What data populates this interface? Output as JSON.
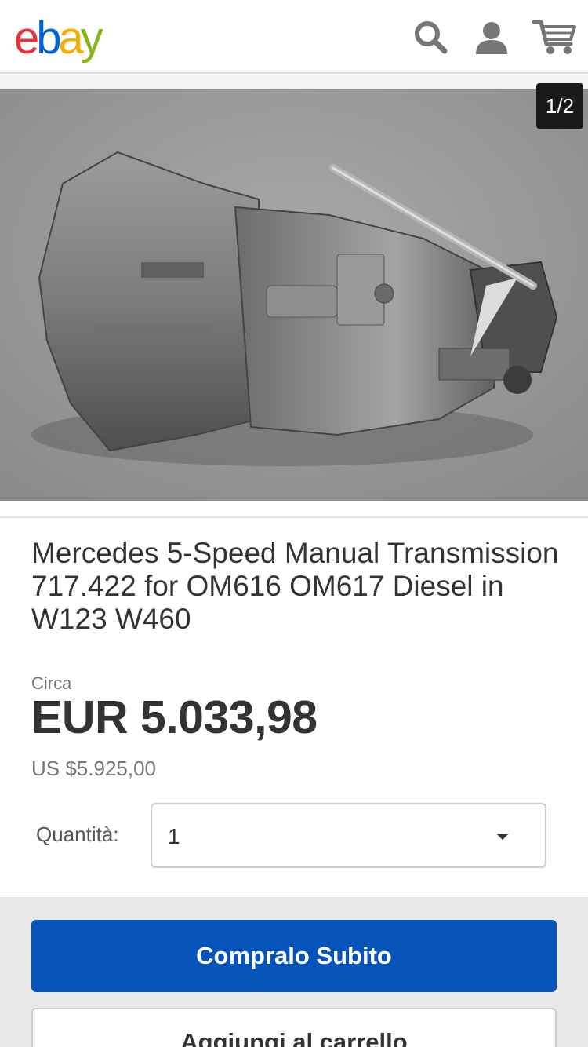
{
  "header": {
    "logo_letters": [
      "e",
      "b",
      "a",
      "y"
    ],
    "logo_colors": [
      "#e53238",
      "#0064d2",
      "#f5af02",
      "#86b817"
    ],
    "icons": [
      "search-icon",
      "user-icon",
      "cart-icon"
    ]
  },
  "gallery": {
    "counter": "1/2",
    "image_subject": "transmission-photo"
  },
  "listing": {
    "title": "Mercedes 5-Speed Manual Transmission 717.422 for OM616 OM617 Diesel in W123 W460",
    "circa_label": "Circa",
    "price": "EUR 5.033,98",
    "price_usd": "US $5.925,00"
  },
  "quantity": {
    "label": "Quantità:",
    "selected": "1"
  },
  "actions": {
    "buy_now": "Compralo Subito",
    "add_to_cart": "Aggiungi al carrello"
  },
  "colors": {
    "accent_blue": "#0654ba",
    "text_dark": "#333333",
    "text_muted": "#767676"
  }
}
